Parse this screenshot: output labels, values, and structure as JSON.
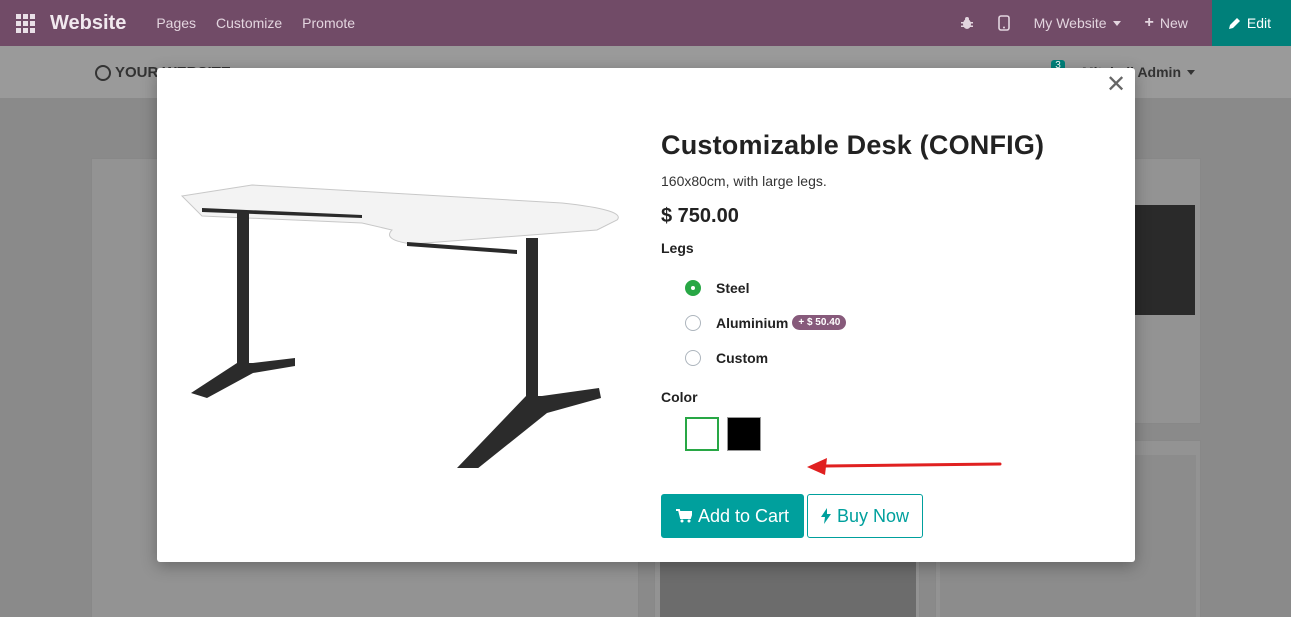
{
  "topbar": {
    "brand": "Website",
    "menu": [
      "Pages",
      "Customize",
      "Promote"
    ],
    "site_selector": "My Website",
    "new_label": "New",
    "edit_label": "Edit"
  },
  "site": {
    "logo_text": "YOUR WEBSITE",
    "cart_count": "3",
    "user_name": "Mitchell Admin"
  },
  "modal": {
    "title": "Customizable Desk (CONFIG)",
    "description": "160x80cm, with large legs.",
    "price": "$ 750.00",
    "legs_label": "Legs",
    "legs_options": [
      {
        "label": "Steel",
        "checked": true,
        "extra": ""
      },
      {
        "label": "Aluminium",
        "checked": false,
        "extra": "+ $ 50.40"
      },
      {
        "label": "Custom",
        "checked": false,
        "extra": ""
      }
    ],
    "color_label": "Color",
    "colors": [
      {
        "name": "White",
        "hex": "#ffffff",
        "selected": true
      },
      {
        "name": "Black",
        "hex": "#000000",
        "selected": false
      }
    ],
    "add_to_cart_label": "Add to Cart",
    "buy_now_label": "Buy Now"
  },
  "colors": {
    "navbar": "#714b67",
    "edit_button": "#00807a",
    "primary": "#00a09d",
    "badge": "#875a7b",
    "selected": "#28a745",
    "annotation_arrow": "#e02020"
  }
}
